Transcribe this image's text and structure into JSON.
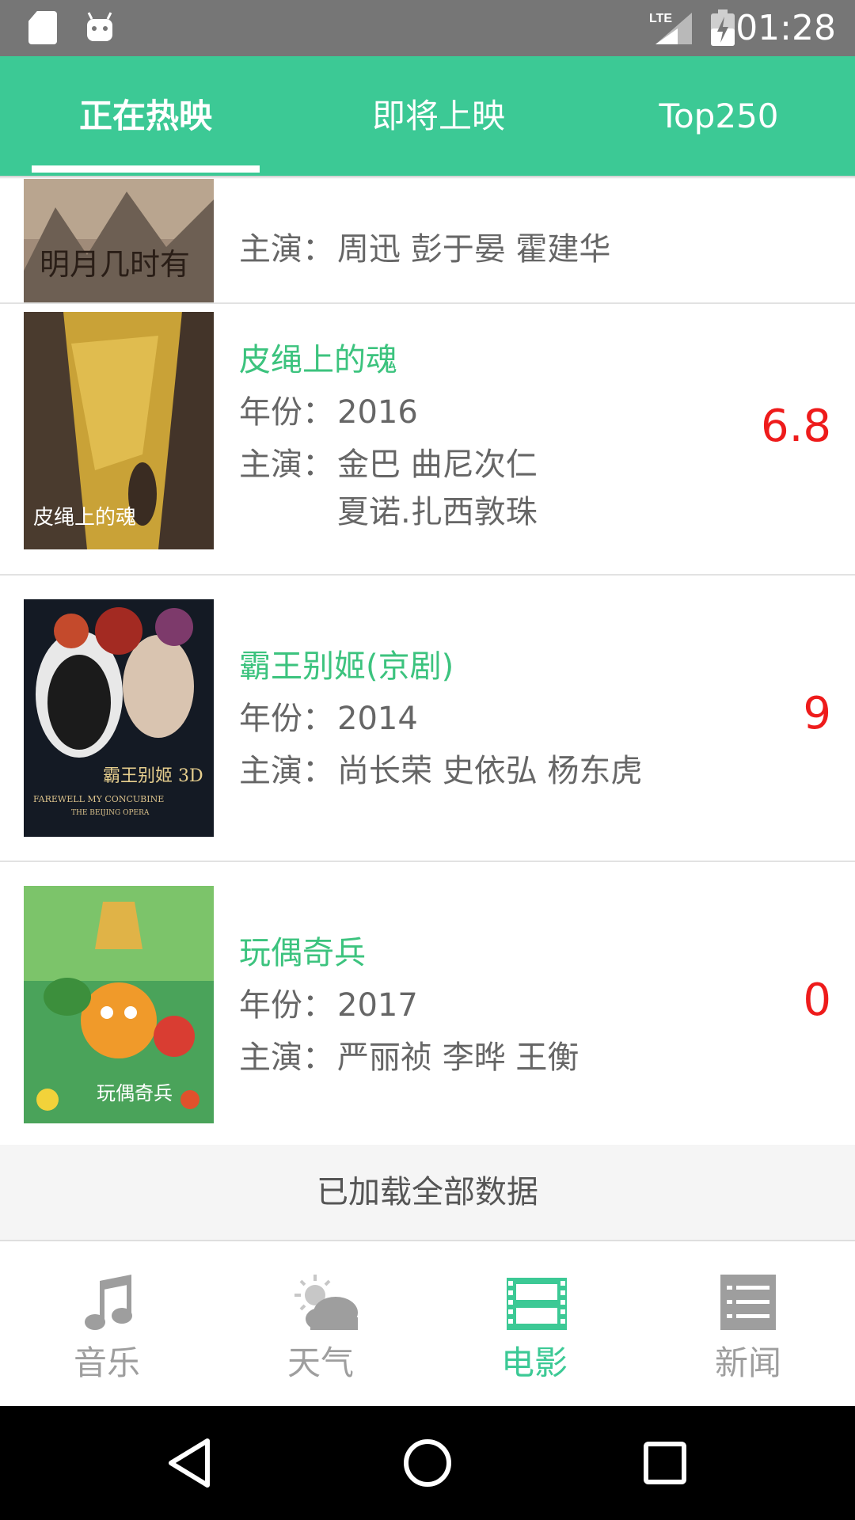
{
  "status_bar": {
    "time": "01:28",
    "network": "LTE"
  },
  "tabs": [
    {
      "label": "正在热映",
      "active": true
    },
    {
      "label": "即将上映",
      "active": false
    },
    {
      "label": "Top250",
      "active": false
    }
  ],
  "movies": [
    {
      "title": "",
      "year_label": "",
      "year": "",
      "cast_label": "主演：",
      "cast_lines": [
        "周迅 彭于晏 霍建华"
      ],
      "rating": "",
      "poster_text": "明月几时有"
    },
    {
      "title": "皮绳上的魂",
      "year_label": "年份：",
      "year": "2016",
      "cast_label": "主演：",
      "cast_lines": [
        "金巴 曲尼次仁",
        "夏诺.扎西敦珠"
      ],
      "rating": "6.8",
      "poster_text": "皮绳上的魂"
    },
    {
      "title": "霸王别姬(京剧)",
      "year_label": "年份：",
      "year": "2014",
      "cast_label": "主演：",
      "cast_lines": [
        "尚长荣 史依弘 杨东虎"
      ],
      "rating": "9",
      "poster_text": "霸王别姬 3D",
      "poster_sub": "FAREWELL MY CONCUBINE",
      "poster_sub2": "THE BEIJING OPERA"
    },
    {
      "title": "玩偶奇兵",
      "year_label": "年份：",
      "year": "2017",
      "cast_label": "主演：",
      "cast_lines": [
        "严丽祯 李晔 王衡"
      ],
      "rating": "0",
      "poster_text": "玩偶奇兵"
    }
  ],
  "footer_message": "已加载全部数据",
  "bottom_nav": [
    {
      "label": "音乐",
      "icon": "music-note-icon",
      "active": false
    },
    {
      "label": "天气",
      "icon": "weather-icon",
      "active": false
    },
    {
      "label": "电影",
      "icon": "film-icon",
      "active": true
    },
    {
      "label": "新闻",
      "icon": "news-list-icon",
      "active": false
    }
  ],
  "colors": {
    "accent": "#3cc995",
    "title_green": "#3cc37e",
    "rating_red": "#ee1b1b",
    "status_bar": "#767676"
  }
}
